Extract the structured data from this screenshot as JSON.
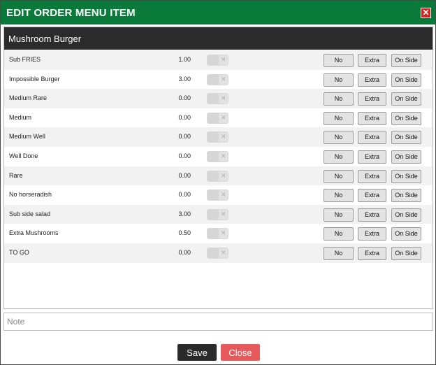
{
  "dialog": {
    "title": "EDIT ORDER MENU ITEM",
    "close_glyph": "✕",
    "close_icon": "close-icon"
  },
  "item": {
    "name": "Mushroom Burger"
  },
  "buttons": {
    "no_label": "No",
    "extra_label": "Extra",
    "side_label": "On Side",
    "toggle_glyph": "✕"
  },
  "modifiers": [
    {
      "name": "Sub FRIES",
      "price": "1.00",
      "enabled": false
    },
    {
      "name": "Impossible Burger",
      "price": "3.00",
      "enabled": false
    },
    {
      "name": "Medium Rare",
      "price": "0.00",
      "enabled": false
    },
    {
      "name": "Medium",
      "price": "0.00",
      "enabled": false
    },
    {
      "name": "Medium Well",
      "price": "0.00",
      "enabled": false
    },
    {
      "name": "Well Done",
      "price": "0.00",
      "enabled": false
    },
    {
      "name": "Rare",
      "price": "0.00",
      "enabled": false
    },
    {
      "name": "No horseradish",
      "price": "0.00",
      "enabled": false
    },
    {
      "name": "Sub side salad",
      "price": "3.00",
      "enabled": false
    },
    {
      "name": "Extra Mushrooms",
      "price": "0.50",
      "enabled": false
    },
    {
      "name": "TO GO",
      "price": "0.00",
      "enabled": false
    }
  ],
  "note": {
    "value": "",
    "placeholder": "Note"
  },
  "footer": {
    "save_label": "Save",
    "cancel_label": "Close"
  },
  "colors": {
    "titlebar": "#0a7a3a",
    "header": "#2b2b2b",
    "close": "#d9211e",
    "save": "#2a2a2a",
    "cancel": "#e75a5c"
  }
}
